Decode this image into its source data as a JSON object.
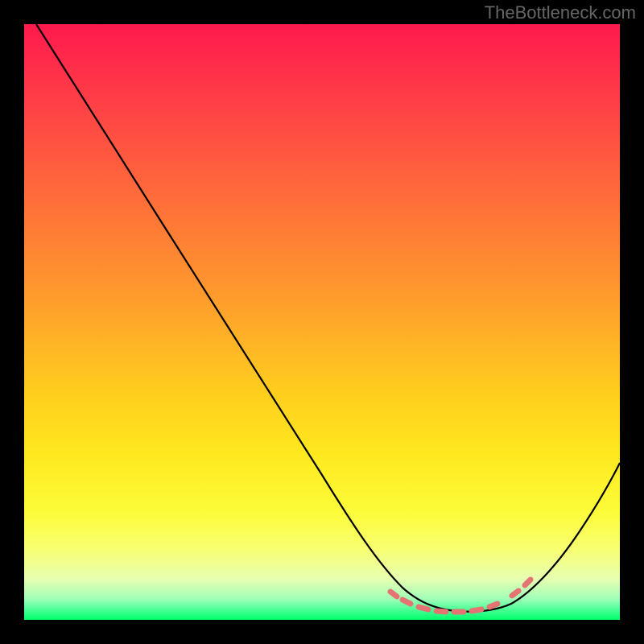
{
  "watermark": "TheBottleneck.com",
  "chart_data": {
    "type": "line",
    "title": "",
    "xlabel": "",
    "ylabel": "",
    "xlim": [
      0,
      100
    ],
    "ylim": [
      0,
      100
    ],
    "grid": false,
    "note": "Values are estimated from pixel positions; y is bottleneck percentage (0 = ideal at bottom, 100 = worst at top).",
    "series": [
      {
        "name": "bottleneck-curve",
        "color": "#000000",
        "x": [
          2,
          10,
          20,
          30,
          40,
          50,
          55,
          60,
          65,
          68,
          70,
          73,
          76,
          79,
          82,
          85,
          90,
          95,
          99
        ],
        "y": [
          100,
          88,
          74,
          60,
          46,
          32,
          25,
          18,
          11,
          7,
          5,
          3,
          2,
          2,
          3,
          5,
          11,
          19,
          27
        ]
      }
    ],
    "markers": {
      "note": "Salmon-colored dashed marker segments near curve minimum",
      "color": "#e57373",
      "points_x": [
        62,
        64,
        66,
        69,
        72,
        75,
        78,
        80,
        82,
        84
      ],
      "points_y": [
        6.0,
        4.7,
        3.7,
        2.8,
        2.3,
        2.2,
        2.5,
        3.2,
        4.0,
        5.0
      ]
    },
    "background_gradient": {
      "direction": "vertical",
      "stops": [
        {
          "pos": 0.0,
          "color": "#ff1a4d"
        },
        {
          "pos": 0.5,
          "color": "#ffb226"
        },
        {
          "pos": 0.82,
          "color": "#fcfc3a"
        },
        {
          "pos": 1.0,
          "color": "#00ff6a"
        }
      ]
    }
  }
}
